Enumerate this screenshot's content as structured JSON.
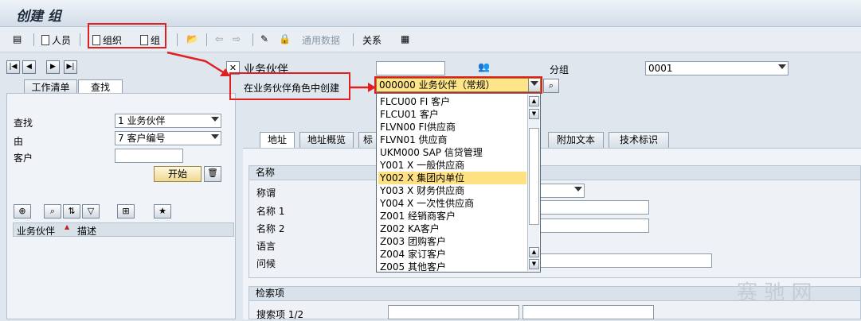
{
  "window": {
    "title": "创建 组"
  },
  "toolbar": {
    "person": "人员",
    "org": "组织",
    "group": "组",
    "general_data": "通用数据",
    "relations": "关系"
  },
  "bp_header": {
    "label": "业务伙伴",
    "group_label": "分组",
    "group_value": "0001",
    "create_in_role": "在业务伙伴角色中创建",
    "role_value": "000000 业务伙伴（常规）"
  },
  "left": {
    "tabs": [
      "工作清单",
      "查找"
    ],
    "find_label": "查找",
    "find_value": "1 业务伙伴",
    "by_label": "由",
    "by_value": "7 客户编号",
    "customer_label": "客户",
    "start_button": "开始",
    "columns": [
      "业务伙伴",
      "描述"
    ]
  },
  "main": {
    "tabs": [
      "地址",
      "地址概览",
      "标",
      "附加文本",
      "技术标识"
    ],
    "name_section": "名称",
    "fields": [
      "称谓",
      "名称 1",
      "名称 2",
      "语言",
      "问候"
    ],
    "search_section": "检索项",
    "search_field": "搜索项 1/2"
  },
  "dropdown": {
    "items": [
      "FLCU00  FI 客户",
      "FLCU01  客户",
      "FLVN00  FI供应商",
      "FLVN01  供应商",
      "UKM000  SAP 信贷管理",
      "Y001  X  一般供应商",
      "Y002  X  集团内单位",
      "Y003  X  财务供应商",
      "Y004  X  一次性供应商",
      "Z001      经销商客户",
      "Z002      KA客户",
      "Z003      团购客户",
      "Z004      家订客户",
      "Z005      其他客户"
    ],
    "selected_index": 6
  },
  "watermark": "赛 驰 网",
  "colors": {
    "annotation_red": "#e02020",
    "selection": "#ffe082"
  }
}
